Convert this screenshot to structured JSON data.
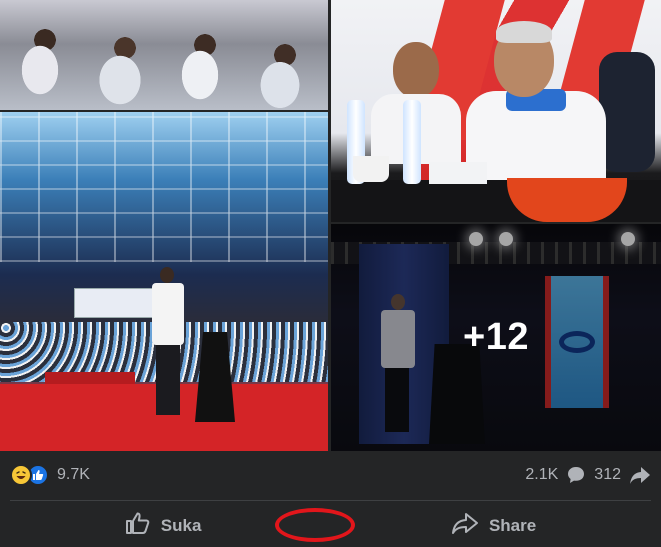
{
  "photos": {
    "more_overlay": "+12"
  },
  "reactions": {
    "count": "9.7K",
    "icons": [
      "haha-icon",
      "like-icon"
    ],
    "comments_count": "2.1K",
    "shares_count": "312"
  },
  "actions": {
    "like_label": "Suka",
    "share_label": "Share"
  },
  "colors": {
    "background": "#242526",
    "secondary_text": "#b0b3b8",
    "like_blue": "#1b74e4",
    "highlight_ring": "#e2161b"
  }
}
